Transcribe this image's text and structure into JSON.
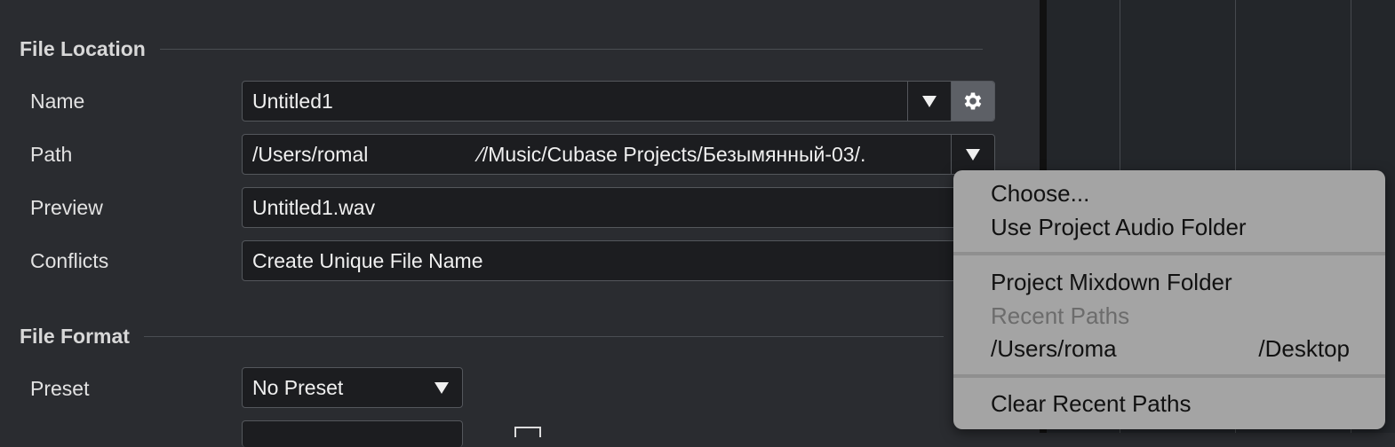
{
  "file_location": {
    "title": "File Location",
    "name": {
      "label": "Name",
      "value": "Untitled1"
    },
    "path": {
      "label": "Path",
      "value_start": "/Users/romal",
      "value_end": "⁄/Music/Cubase Projects/Безымянный-03/."
    },
    "preview": {
      "label": "Preview",
      "value": "Untitled1.wav"
    },
    "conflicts": {
      "label": "Conflicts",
      "value": "Create Unique File Name"
    }
  },
  "file_format": {
    "title": "File Format",
    "preset": {
      "label": "Preset",
      "value": "No Preset"
    }
  },
  "path_menu": {
    "choose": "Choose...",
    "use_project_audio_folder": "Use Project Audio Folder",
    "project_mixdown_folder": "Project Mixdown Folder",
    "recent_paths_header": "Recent Paths",
    "recent_path_start": "/Users/roma",
    "recent_path_end": "/Desktop",
    "clear_recent_paths": "Clear Recent Paths"
  },
  "icons": {
    "dropdown": "triangle-down-icon",
    "settings": "gear-icon"
  },
  "colors": {
    "panel_bg": "#2a2c30",
    "field_bg": "#1c1d20",
    "menu_bg": "#a4a4a4",
    "gear_button_bg": "#5d6066"
  }
}
